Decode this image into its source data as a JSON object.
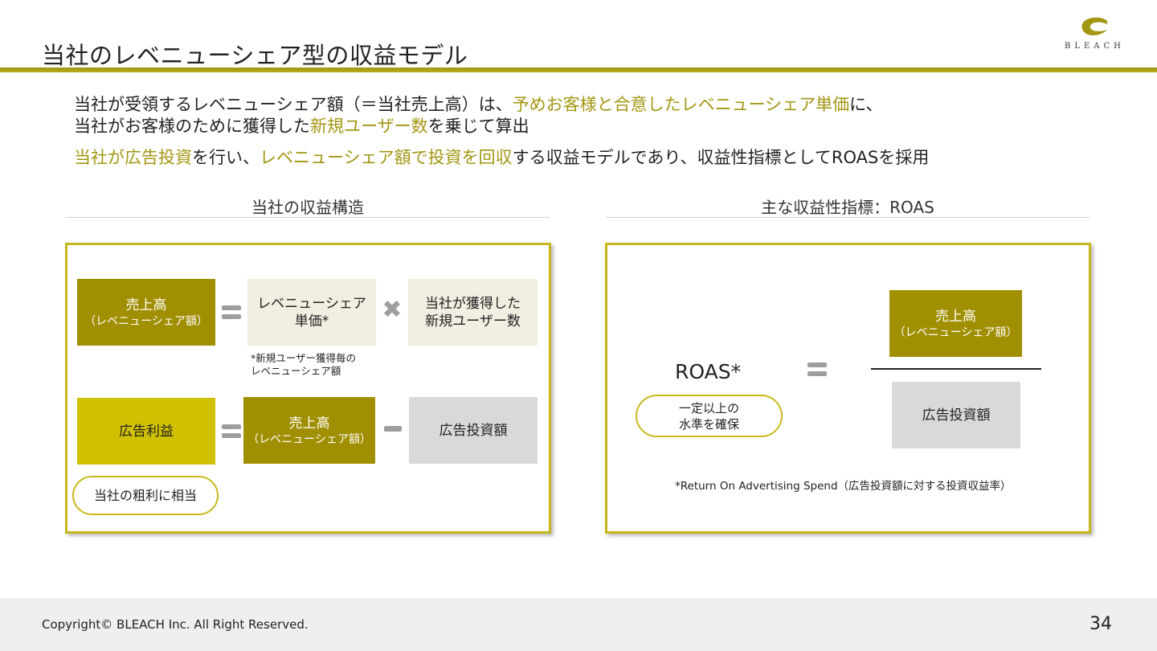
{
  "slide": {
    "title": "当社のレベニューシェア型の収益モデル",
    "logo_text": "BLEACH",
    "page_number": "34",
    "copyright": "Copyright© BLEACH Inc. All Right Reserved."
  },
  "intro": {
    "line1_a": "当社が受領するレベニューシェア額（＝当社売上高）は、",
    "line1_hl": "予めお客様と合意したレベニューシェア単価",
    "line1_b": "に、",
    "line2_a": "当社がお客様のために獲得した",
    "line2_hl": "新規ユーザー数",
    "line2_b": "を乗じて算出",
    "line3_hl1": "当社が広告投資",
    "line3_a": "を行い、",
    "line3_hl2": "レベニューシェア額で投資を回収",
    "line3_b": "する収益モデルであり、収益性指標としてROASを採用"
  },
  "left": {
    "section_title": "当社の収益構造",
    "row1": {
      "sales_main": "売上高",
      "sales_sub": "（レベニューシェア額）",
      "unit_line1": "レベニューシェア",
      "unit_line2": "単価*",
      "users_line1": "当社が獲得した",
      "users_line2": "新規ユーザー数",
      "note_line1": "*新規ユーザー獲得毎の",
      "note_line2": "レベニューシェア額"
    },
    "row2": {
      "profit": "広告利益",
      "sales_main": "売上高",
      "sales_sub": "（レベニューシェア額）",
      "ad_invest": "広告投資額",
      "pill": "当社の粗利に相当"
    }
  },
  "right": {
    "section_title": "主な収益性指標：ROAS",
    "roas_label": "ROAS*",
    "pill_line1": "一定以上の",
    "pill_line2": "水準を確保",
    "numerator_main": "売上高",
    "numerator_sub": "（レベニューシェア額）",
    "denominator": "広告投資額",
    "footnote": "*Return On Advertising Spend（広告投資額に対する投資収益率）"
  },
  "colors": {
    "accent_dark": "#a08f00",
    "accent_yellow": "#cfc000",
    "highlight_text": "#a39613",
    "cream": "#f1eee2",
    "grey": "#d9d9d9"
  }
}
